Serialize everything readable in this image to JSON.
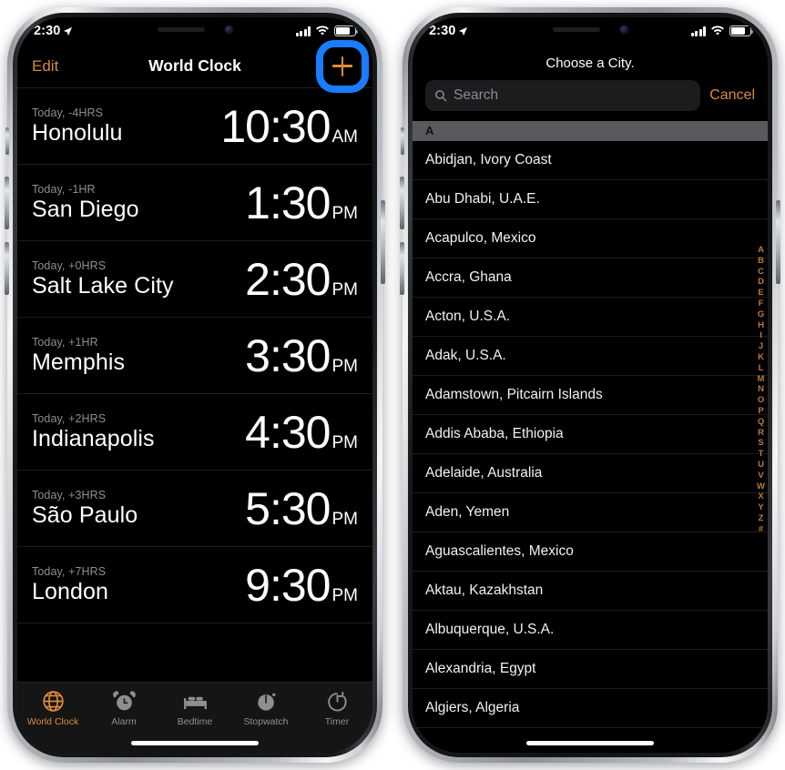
{
  "status_bar": {
    "time": "2:30",
    "location_icon": "location-arrow-icon",
    "signal_icon": "cellular-bars-icon",
    "wifi_icon": "wifi-icon",
    "battery_icon": "battery-icon"
  },
  "phone_left": {
    "nav": {
      "edit_label": "Edit",
      "title": "World Clock",
      "add_icon": "plus-icon",
      "highlight_color": "#1a7cff",
      "accent_color": "#e08b3c"
    },
    "clocks": [
      {
        "offset": "Today, -4HRS",
        "city": "Honolulu",
        "time": "10:30",
        "period": "AM"
      },
      {
        "offset": "Today, -1HR",
        "city": "San Diego",
        "time": "1:30",
        "period": "PM"
      },
      {
        "offset": "Today, +0HRS",
        "city": "Salt Lake City",
        "time": "2:30",
        "period": "PM"
      },
      {
        "offset": "Today, +1HR",
        "city": "Memphis",
        "time": "3:30",
        "period": "PM"
      },
      {
        "offset": "Today, +2HRS",
        "city": "Indianapolis",
        "time": "4:30",
        "period": "PM"
      },
      {
        "offset": "Today, +3HRS",
        "city": "São Paulo",
        "time": "5:30",
        "period": "PM"
      },
      {
        "offset": "Today, +7HRS",
        "city": "London",
        "time": "9:30",
        "period": "PM"
      }
    ],
    "tabs": [
      {
        "label": "World Clock",
        "icon": "globe-icon",
        "active": true
      },
      {
        "label": "Alarm",
        "icon": "alarm-clock-icon",
        "active": false
      },
      {
        "label": "Bedtime",
        "icon": "bed-icon",
        "active": false
      },
      {
        "label": "Stopwatch",
        "icon": "stopwatch-icon",
        "active": false
      },
      {
        "label": "Timer",
        "icon": "timer-icon",
        "active": false
      }
    ]
  },
  "phone_right": {
    "title": "Choose a City.",
    "search": {
      "placeholder": "Search",
      "value": "",
      "icon": "search-icon",
      "cancel_label": "Cancel"
    },
    "section_header": "A",
    "cities": [
      "Abidjan, Ivory Coast",
      "Abu Dhabi, U.A.E.",
      "Acapulco, Mexico",
      "Accra, Ghana",
      "Acton, U.S.A.",
      "Adak, U.S.A.",
      "Adamstown, Pitcairn Islands",
      "Addis Ababa, Ethiopia",
      "Adelaide, Australia",
      "Aden, Yemen",
      "Aguascalientes, Mexico",
      "Aktau, Kazakhstan",
      "Albuquerque, U.S.A.",
      "Alexandria, Egypt",
      "Algiers, Algeria"
    ],
    "alphabet_index": [
      "A",
      "B",
      "C",
      "D",
      "E",
      "F",
      "G",
      "H",
      "I",
      "J",
      "K",
      "L",
      "M",
      "N",
      "O",
      "P",
      "Q",
      "R",
      "S",
      "T",
      "U",
      "V",
      "W",
      "X",
      "Y",
      "Z",
      "#"
    ]
  }
}
